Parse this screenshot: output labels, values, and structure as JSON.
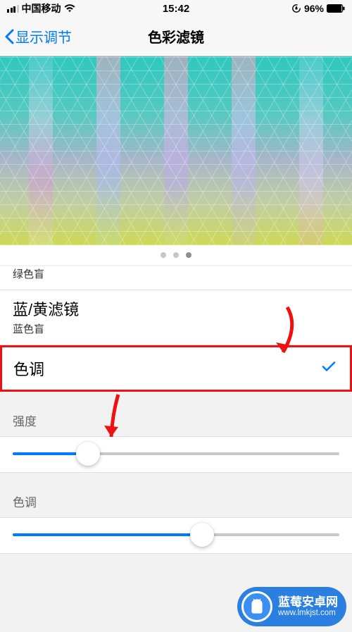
{
  "status": {
    "carrier": "中国移动",
    "time": "15:42",
    "battery": "96%"
  },
  "nav": {
    "back": "显示调节",
    "title": "色彩滤镜"
  },
  "pager": {
    "count": 3,
    "active": 2
  },
  "options": {
    "green": {
      "sub": "绿色盲"
    },
    "blue_yellow": {
      "title": "蓝/黄滤镜",
      "sub": "蓝色盲"
    },
    "tint": {
      "title": "色调"
    }
  },
  "sliders": {
    "intensity": {
      "label": "强度",
      "value": 23
    },
    "hue": {
      "label": "色调",
      "value": 58
    }
  },
  "watermark": {
    "title": "蓝莓安卓网",
    "url": "www.lmkjst.com"
  }
}
